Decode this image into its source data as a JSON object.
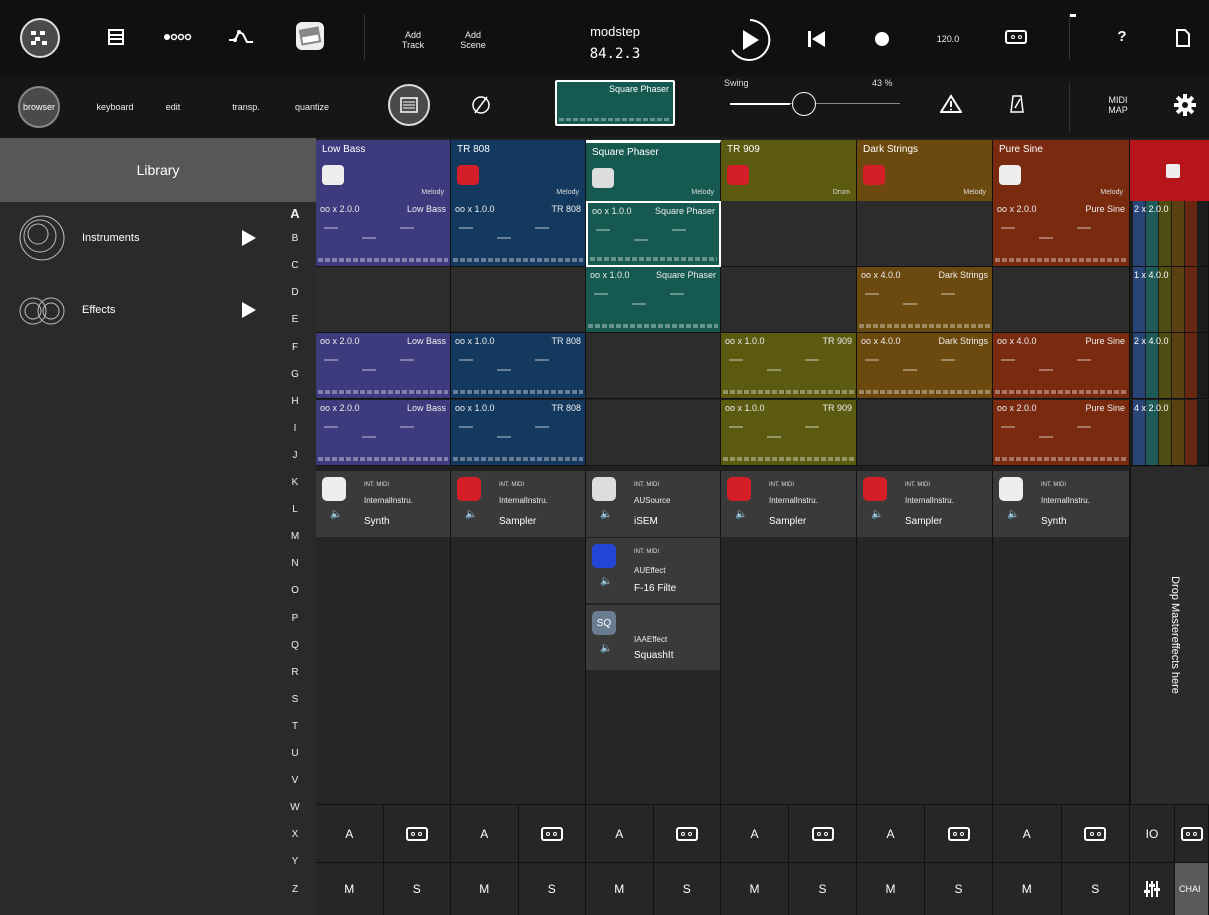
{
  "toolbar": {
    "add_track": "Add\nTrack",
    "add_scene": "Add\nScene",
    "title": "modstep",
    "position": "84.2.3",
    "tempo": "120.0",
    "help": "?"
  },
  "subbar": {
    "browser": "browser",
    "keyboard": "keyboard",
    "edit": "edit",
    "transp": "transp.",
    "quantize": "quantize",
    "current_clip": "Square Phaser",
    "swing_label": "Swing",
    "swing_value": "43 %",
    "midi_map": "MIDI\nMAP"
  },
  "sidebar": {
    "title": "Library",
    "items": [
      {
        "label": "Instruments"
      },
      {
        "label": "Effects"
      }
    ],
    "alphabet": [
      "A",
      "B",
      "C",
      "D",
      "E",
      "F",
      "G",
      "H",
      "I",
      "J",
      "K",
      "L",
      "M",
      "N",
      "O",
      "P",
      "Q",
      "R",
      "S",
      "T",
      "U",
      "V",
      "W",
      "X",
      "Y",
      "Z"
    ]
  },
  "tracks": [
    {
      "name": "Low Bass",
      "type": "Melody",
      "color": "#3d3a7e",
      "inst_midi": "INT. MIDI",
      "inst_type": "InternalInstru.",
      "inst_name": "Synth"
    },
    {
      "name": "TR 808",
      "type": "Melody",
      "color": "#14395f",
      "inst_midi": "INT. MIDI",
      "inst_type": "InternalInstru.",
      "inst_name": "Sampler"
    },
    {
      "name": "Square Phaser",
      "type": "Melody",
      "color": "#155951",
      "inst_midi": "INT. MIDI",
      "inst_type": "AUSource",
      "inst_name": "iSEM"
    },
    {
      "name": "TR 909",
      "type": "Drum",
      "color": "#5b5a10",
      "inst_midi": "INT. MIDI",
      "inst_type": "InternalInstru.",
      "inst_name": "Sampler"
    },
    {
      "name": "Dark Strings",
      "type": "Melody",
      "color": "#6c4a0f",
      "inst_midi": "INT. MIDI",
      "inst_type": "InternalInstru.",
      "inst_name": "Sampler"
    },
    {
      "name": "Pure Sine",
      "type": "Melody",
      "color": "#7a2b0f",
      "inst_midi": "INT. MIDI",
      "inst_type": "InternalInstru.",
      "inst_name": "Synth"
    }
  ],
  "clips": {
    "r0": [
      {
        "a": "oo x  2.0.0",
        "b": "Low Bass"
      },
      {
        "a": "oo x  1.0.0",
        "b": "TR 808"
      },
      {
        "a": "oo x  1.0.0",
        "b": "Square Phaser"
      },
      null,
      null,
      {
        "a": "oo x  2.0.0",
        "b": "Pure Sine"
      }
    ],
    "r1": [
      null,
      null,
      {
        "a": "oo x  1.0.0",
        "b": "Square Phaser"
      },
      null,
      {
        "a": "oo x  4.0.0",
        "b": "Dark Strings"
      },
      null
    ],
    "r2": [
      {
        "a": "oo x  2.0.0",
        "b": "Low Bass"
      },
      {
        "a": "oo x  1.0.0",
        "b": "TR 808"
      },
      null,
      {
        "a": "oo x  1.0.0",
        "b": "TR 909"
      },
      {
        "a": "oo x  4.0.0",
        "b": "Dark Strings"
      },
      {
        "a": "oo x  4.0.0",
        "b": "Pure Sine"
      }
    ],
    "r3": [
      {
        "a": "oo x  2.0.0",
        "b": "Low Bass"
      },
      {
        "a": "oo x  1.0.0",
        "b": "TR 808"
      },
      null,
      {
        "a": "oo x  1.0.0",
        "b": "TR 909"
      },
      null,
      {
        "a": "oo x  2.0.0",
        "b": "Pure Sine"
      }
    ]
  },
  "master": {
    "clips": [
      "2 x  2.0.0",
      "1 x  4.0.0",
      "2 x  4.0.0",
      "4 x  2.0.0"
    ],
    "drop_text": "Drop Mastereffects here",
    "io": "IO",
    "chain": "CHAI"
  },
  "effects": [
    {
      "midi": "INT. MIDI",
      "type": "AUEffect",
      "name": "F-16 Filte"
    },
    {
      "midi": "",
      "type": "IAAEffect",
      "name": "SquashIt",
      "icon_text": "SQ"
    }
  ],
  "buttons": {
    "a": "A",
    "m": "M",
    "s": "S"
  }
}
